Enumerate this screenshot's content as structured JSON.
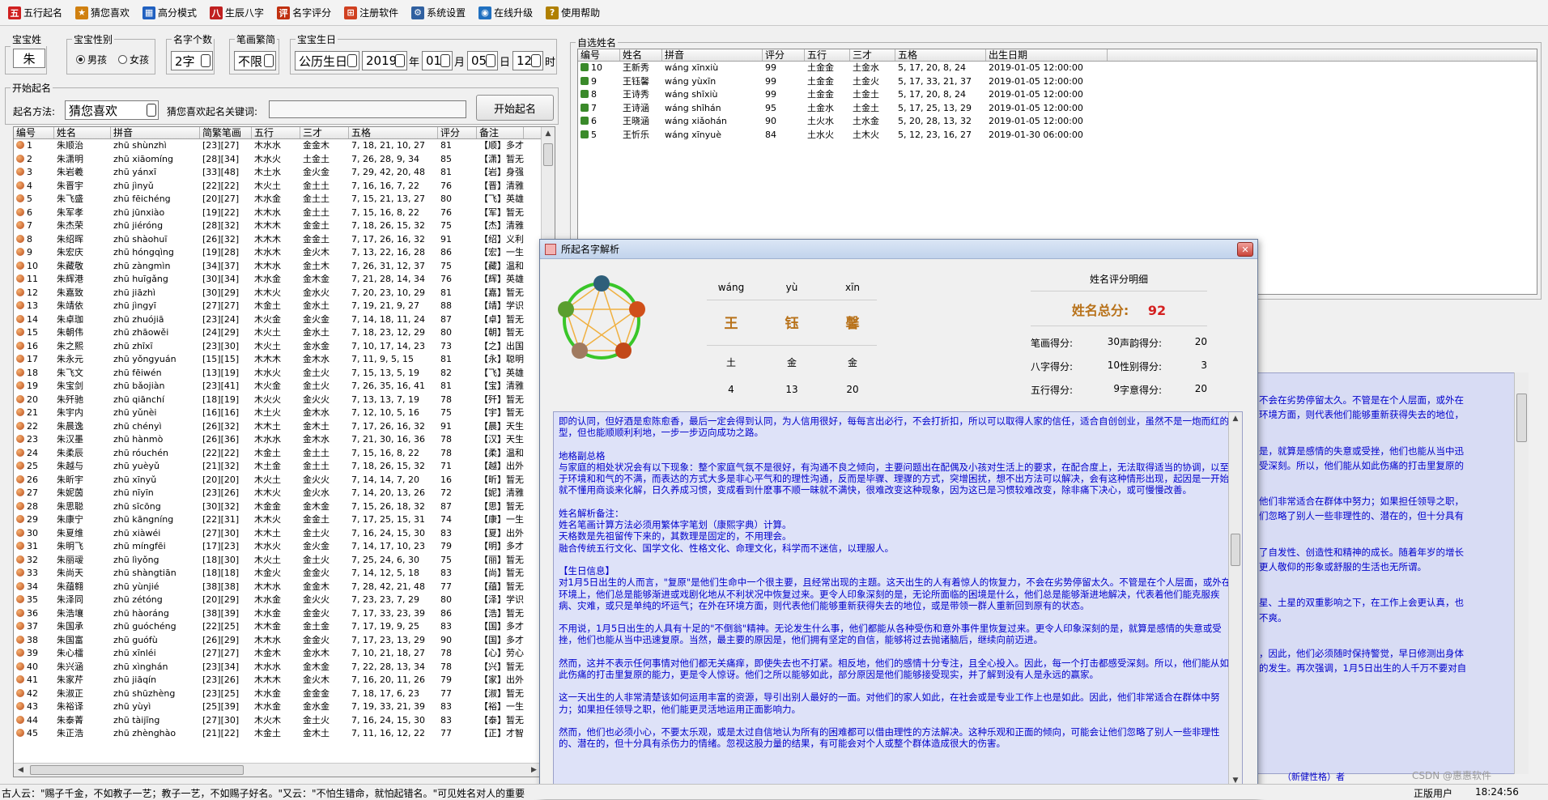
{
  "toolbar": [
    {
      "label": "五行起名",
      "icon": "book-icon",
      "color": "#d02020"
    },
    {
      "label": "猜您喜欢",
      "icon": "star-icon",
      "color": "#d08010"
    },
    {
      "label": "高分模式",
      "icon": "chart-icon",
      "color": "#2060c0"
    },
    {
      "label": "生辰八字",
      "icon": "calendar-icon",
      "color": "#c02020"
    },
    {
      "label": "名字评分",
      "icon": "score-icon",
      "color": "#c03010"
    },
    {
      "label": "注册软件",
      "icon": "gift-icon",
      "color": "#d04020"
    },
    {
      "label": "系统设置",
      "icon": "settings-icon",
      "color": "#3060a0"
    },
    {
      "label": "在线升级",
      "icon": "globe-icon",
      "color": "#2070c0"
    },
    {
      "label": "使用帮助",
      "icon": "help-icon",
      "color": "#b08000"
    }
  ],
  "baby": {
    "surname_label": "宝宝姓氏",
    "surname": "朱",
    "gender_label": "宝宝性别",
    "male": "男孩",
    "female": "女孩",
    "count_label": "名字个数",
    "count": "2字",
    "stroke_label": "笔画繁简",
    "stroke": "不限",
    "birth_label": "宝宝生日",
    "calendar": "公历生日",
    "year": "2019",
    "year_unit": "年",
    "month": "01",
    "month_unit": "月",
    "day": "05",
    "day_unit": "日",
    "hour": "12",
    "hour_unit": "时"
  },
  "start": {
    "label": "开始起名",
    "method_label": "起名方法:",
    "method": "猜您喜欢",
    "keyword_label": "猜您喜欢起名关键词:",
    "keyword": "",
    "button": "开始起名"
  },
  "names_table": {
    "columns": [
      "编号",
      "姓名",
      "拼音",
      "简繁笔画",
      "五行",
      "三才",
      "五格",
      "评分",
      "备注"
    ],
    "rows": [
      [
        "1",
        "朱顺治",
        "zhū shùnzhì",
        "[23][27]",
        "木水水",
        "金金木",
        "7, 18, 21, 10, 27",
        "81",
        "【顺】多才"
      ],
      [
        "2",
        "朱潇明",
        "zhū xiāomíng",
        "[28][34]",
        "木水火",
        "土金土",
        "7, 26, 28, 9, 34",
        "85",
        "【潇】暂无"
      ],
      [
        "3",
        "朱岩羲",
        "zhū yánxī",
        "[33][48]",
        "木土水",
        "金火金",
        "7, 29, 42, 20, 48",
        "81",
        "【岩】身强"
      ],
      [
        "4",
        "朱晋宇",
        "zhū jìnyǔ",
        "[22][22]",
        "木火土",
        "金土土",
        "7, 16, 16, 7, 22",
        "76",
        "【晋】清雅"
      ],
      [
        "5",
        "朱飞盛",
        "zhū fēichéng",
        "[20][27]",
        "木水金",
        "金土土",
        "7, 15, 21, 13, 27",
        "80",
        "【飞】英雄"
      ],
      [
        "6",
        "朱军孝",
        "zhū jūnxiào",
        "[19][22]",
        "木木水",
        "金土土",
        "7, 15, 16, 8, 22",
        "76",
        "【军】暂无"
      ],
      [
        "7",
        "朱杰荣",
        "zhū jiéróng",
        "[28][32]",
        "木木木",
        "金金土",
        "7, 18, 26, 15, 32",
        "75",
        "【杰】清雅"
      ],
      [
        "8",
        "朱绍晖",
        "zhū shàohuī",
        "[26][32]",
        "木木木",
        "金金土",
        "7, 17, 26, 16, 32",
        "91",
        "【绍】义利"
      ],
      [
        "9",
        "朱宏庆",
        "zhū hóngqìng",
        "[19][28]",
        "木水木",
        "金火木",
        "7, 13, 22, 16, 28",
        "86",
        "【宏】一生"
      ],
      [
        "10",
        "朱藏敬",
        "zhū zàngmìn",
        "[34][37]",
        "木木水",
        "金土木",
        "7, 26, 31, 12, 37",
        "75",
        "【藏】温和"
      ],
      [
        "11",
        "朱辉港",
        "zhū huīgǎng",
        "[30][34]",
        "木水金",
        "金木金",
        "7, 21, 28, 14, 34",
        "76",
        "【辉】英雄"
      ],
      [
        "12",
        "朱嘉致",
        "zhū jiāzhì",
        "[30][29]",
        "木木火",
        "金水火",
        "7, 20, 23, 10, 29",
        "81",
        "【嘉】暂无"
      ],
      [
        "13",
        "朱靖依",
        "zhū jìngyī",
        "[27][27]",
        "木金土",
        "金水土",
        "7, 19, 21, 9, 27",
        "88",
        "【靖】学识"
      ],
      [
        "14",
        "朱卓珈",
        "zhū zhuójiā",
        "[23][24]",
        "木火金",
        "金火金",
        "7, 14, 18, 11, 24",
        "87",
        "【卓】暂无"
      ],
      [
        "15",
        "朱朝伟",
        "zhū zhāowěi",
        "[24][29]",
        "木火土",
        "金水土",
        "7, 18, 23, 12, 29",
        "80",
        "【朝】暂无"
      ],
      [
        "16",
        "朱之熙",
        "zhū zhīxī",
        "[23][30]",
        "木火土",
        "金水金",
        "7, 10, 17, 14, 23",
        "73",
        "【之】出国"
      ],
      [
        "17",
        "朱永元",
        "zhū yǒngyuán",
        "[15][15]",
        "木木木",
        "金木水",
        "7, 11, 9, 5, 15",
        "81",
        "【永】聪明"
      ],
      [
        "18",
        "朱飞文",
        "zhū fēiwén",
        "[13][19]",
        "木水火",
        "金土火",
        "7, 15, 13, 5, 19",
        "82",
        "【飞】英雄"
      ],
      [
        "19",
        "朱宝剑",
        "zhū bǎojiàn",
        "[23][41]",
        "木火金",
        "金土火",
        "7, 26, 35, 16, 41",
        "81",
        "【宝】清雅"
      ],
      [
        "20",
        "朱歼驰",
        "zhū qiānchí",
        "[18][19]",
        "木火火",
        "金火火",
        "7, 13, 13, 7, 19",
        "78",
        "【歼】暂无"
      ],
      [
        "21",
        "朱宇内",
        "zhū yǔnèi",
        "[16][16]",
        "木土火",
        "金木水",
        "7, 12, 10, 5, 16",
        "75",
        "【宇】暂无"
      ],
      [
        "22",
        "朱晨逸",
        "zhū chényì",
        "[26][32]",
        "木木土",
        "金木土",
        "7, 17, 26, 16, 32",
        "91",
        "【晨】天生"
      ],
      [
        "23",
        "朱汉墨",
        "zhū hànmò",
        "[26][36]",
        "木水水",
        "金木水",
        "7, 21, 30, 16, 36",
        "78",
        "【汉】天生"
      ],
      [
        "24",
        "朱柔辰",
        "zhū róuchén",
        "[22][22]",
        "木金土",
        "金土土",
        "7, 15, 16, 8, 22",
        "78",
        "【柔】温和"
      ],
      [
        "25",
        "朱越与",
        "zhū yuèyǔ",
        "[21][32]",
        "木土金",
        "金土土",
        "7, 18, 26, 15, 32",
        "71",
        "【越】出外"
      ],
      [
        "26",
        "朱昕宇",
        "zhū xīnyǔ",
        "[20][20]",
        "木火土",
        "金火火",
        "7, 14, 14, 7, 20",
        "16",
        "【昕】暂无"
      ],
      [
        "27",
        "朱妮茵",
        "zhū nīyīn",
        "[23][26]",
        "木木火",
        "金火水",
        "7, 14, 20, 13, 26",
        "72",
        "【妮】清雅"
      ],
      [
        "28",
        "朱思聪",
        "zhū sīcōng",
        "[30][32]",
        "木金金",
        "金木金",
        "7, 15, 26, 18, 32",
        "87",
        "【思】暂无"
      ],
      [
        "29",
        "朱康宁",
        "zhū kāngníng",
        "[22][31]",
        "木木火",
        "金金土",
        "7, 17, 25, 15, 31",
        "74",
        "【康】一生"
      ],
      [
        "30",
        "朱夏维",
        "zhū xiàwéi",
        "[27][30]",
        "木木土",
        "金土火",
        "7, 16, 24, 15, 30",
        "83",
        "【夏】出外"
      ],
      [
        "31",
        "朱明飞",
        "zhū míngfēi",
        "[17][23]",
        "木水火",
        "金火金",
        "7, 14, 17, 10, 23",
        "79",
        "【明】多才"
      ],
      [
        "32",
        "朱丽叆",
        "zhū lìyǒng",
        "[18][30]",
        "木火土",
        "金土火",
        "7, 25, 24, 6, 30",
        "75",
        "【丽】暂无"
      ],
      [
        "33",
        "朱尚天",
        "zhū shàngtiān",
        "[18][18]",
        "木金火",
        "金金火",
        "7, 14, 12, 5, 18",
        "83",
        "【尚】暂无"
      ],
      [
        "34",
        "朱蕴翱",
        "zhū yùnjié",
        "[38][38]",
        "木木水",
        "金金木",
        "7, 28, 42, 21, 48",
        "77",
        "【蕴】暂无"
      ],
      [
        "35",
        "朱泽同",
        "zhū zétóng",
        "[20][29]",
        "木水金",
        "金火火",
        "7, 23, 23, 7, 29",
        "80",
        "【泽】学识"
      ],
      [
        "36",
        "朱浩壤",
        "zhū hàoráng",
        "[38][39]",
        "木水金",
        "金金火",
        "7, 17, 33, 23, 39",
        "86",
        "【浩】暂无"
      ],
      [
        "37",
        "朱国承",
        "zhū guóchéng",
        "[22][25]",
        "木木金",
        "金土金",
        "7, 17, 19, 9, 25",
        "83",
        "【国】多才"
      ],
      [
        "38",
        "朱国富",
        "zhū guófù",
        "[26][29]",
        "木木水",
        "金金火",
        "7, 17, 23, 13, 29",
        "90",
        "【国】多才"
      ],
      [
        "39",
        "朱心檑",
        "zhū xīnléi",
        "[27][27]",
        "木金木",
        "金水木",
        "7, 10, 21, 18, 27",
        "78",
        "【心】劳心"
      ],
      [
        "40",
        "朱兴涵",
        "zhū xìnghán",
        "[23][34]",
        "木水水",
        "金木金",
        "7, 22, 28, 13, 34",
        "78",
        "【兴】暂无"
      ],
      [
        "41",
        "朱家芹",
        "zhū jiāqín",
        "[23][26]",
        "木木木",
        "金火木",
        "7, 16, 20, 11, 26",
        "79",
        "【家】出外"
      ],
      [
        "42",
        "朱淑正",
        "zhū shūzhèng",
        "[23][25]",
        "木水金",
        "金金金",
        "7, 18, 17, 6, 23",
        "77",
        "【淑】暂无"
      ],
      [
        "43",
        "朱裕译",
        "zhū yùyì",
        "[25][39]",
        "木水金",
        "金水金",
        "7, 19, 33, 21, 39",
        "83",
        "【裕】一生"
      ],
      [
        "44",
        "朱泰菁",
        "zhū tàijīng",
        "[27][30]",
        "木火木",
        "金土火",
        "7, 16, 24, 15, 30",
        "83",
        "【泰】暂无"
      ],
      [
        "45",
        "朱正浩",
        "zhū zhènghào",
        "[21][22]",
        "木金土",
        "金木土",
        "7, 11, 16, 12, 22",
        "77",
        "【正】才智"
      ]
    ]
  },
  "selected": {
    "title": "自选姓名",
    "columns": [
      "编号",
      "姓名",
      "拼音",
      "评分",
      "五行",
      "三才",
      "五格",
      "出生日期"
    ],
    "rows": [
      [
        "10",
        "王新秀",
        "wáng xīnxiù",
        "99",
        "土金金",
        "土金水",
        "5, 17, 20, 8, 24",
        "2019-01-05 12:00:00"
      ],
      [
        "9",
        "王钰馨",
        "wáng yùxīn",
        "99",
        "土金金",
        "土金火",
        "5, 17, 33, 21, 37",
        "2019-01-05 12:00:00"
      ],
      [
        "8",
        "王诗秀",
        "wáng shīxiù",
        "99",
        "土金金",
        "土金土",
        "5, 17, 20, 8, 24",
        "2019-01-05 12:00:00"
      ],
      [
        "7",
        "王诗涵",
        "wáng shīhán",
        "95",
        "土金水",
        "土金土",
        "5, 17, 25, 13, 29",
        "2019-01-05 12:00:00"
      ],
      [
        "6",
        "王晓涵",
        "wáng xiǎohán",
        "90",
        "土火水",
        "土水金",
        "5, 20, 28, 13, 32",
        "2019-01-05 12:00:00"
      ],
      [
        "5",
        "王忻乐",
        "wáng xīnyuè",
        "84",
        "土水火",
        "土木火",
        "5, 12, 23, 16, 27",
        "2019-01-30 06:00:00"
      ]
    ]
  },
  "dialog": {
    "title": "所起名字解析",
    "pinyin": [
      "wáng",
      "yù",
      "xīn"
    ],
    "chars": [
      "王",
      "钰",
      "馨"
    ],
    "elements": [
      "土",
      "金",
      "金"
    ],
    "strokes": [
      "4",
      "13",
      "20"
    ],
    "detail_title": "姓名评分明细",
    "total_label": "姓名总分:",
    "total": "92",
    "scores": [
      [
        "笔画得分:",
        "30",
        "声韵得分:",
        "20"
      ],
      [
        "八字得分:",
        "10",
        "性别得分:",
        "3"
      ],
      [
        "五行得分:",
        "9",
        "字意得分:",
        "20"
      ]
    ],
    "paragraphs": [
      "即的认同，但好酒是愈陈愈香，最后一定会得到认同，为人信用很好，每每言出必行，不会打折扣，所以可以取得人家的信任，适合自创创业，虽然不是一炮而红的型，但也能顺顺利利地，一步一步迈向成功之路。",
      "地格副总格\n与家庭的相处状况会有以下现象：整个家庭气氛不是很好，有沟通不良之倾向，主要问题出在配偶及小孩对生活上的要求，在配合度上，无法取得适当的协调，以至于环境和和气的不满，而表达的方式大多是非心平气和的理性沟通，反而是毕骤、理骤的方式，突增困扰，想不出方法可以解决，会有这种情形出现，起因是一开始就不懂用商谈来化解，日久养成习惯，变成看到什麽事不顺一昧就不满快，很难改变这种现象，因为这已是习惯较难改变，除非痛下决心，或可慢慢改善。",
      "姓名解析备注：\n姓名笔画计算方法必须用繁体字笔划（康熙字典）计算。\n天格数是先祖留传下来的，其数理是固定的，不用理会。\n融合传统五行文化、国学文化、性格文化、命理文化，科学而不迷信，以理服人。",
      "【生日信息】\n对1月5日出生的人而言，\"复原\"是他们生命中一个很主要，且经常出现的主题。这天出生的人有着惊人的恢复力，不会在劣势停留太久。不管是在个人层面，或外在环境上，他们总是能够渐进或戏剧化地从不利状况中恢复过来。更令人印象深刻的是，无论所面临的困境是什么，他们总是能够渐进地解决，代表着他们能克服疾病、灾难，或只是单纯的坏运气；在外在环境方面，则代表他们能够重新获得失去的地位，或是带领一群人重新回到原有的状态。",
      "不用说，1月5日出生的人具有十足的\"不倒翁\"精神。无论发生什么事，他们都能从各种受伤和意外事件里恢复过来。更令人印象深刻的是，就算是感情的失意或受挫，他们也能从当中迅速复原。当然，最主要的原因是，他们拥有坚定的自信，能够将过去抛诸脑后，继续向前迈进。",
      "然而，这并不表示任何事情对他们都无关痛痒，即使失去也不打紧。相反地，他们的感情十分专注，且全心投入。因此，每一个打击都感受深刻。所以，他们能从如此伤痛的打击里复原的能力，更是令人惊讶。他们之所以能够如此，部分原因是他们能够接受现实，并了解到没有人是永远的赢家。",
      "这一天出生的人非常清楚该如何运用丰富的资源，导引出别人最好的一面。对他们的家人如此，在社会或是专业工作上也是如此。因此，他们非常适合在群体中努力；如果担任领导之职，他们能更灵活地运用正面影响力。",
      "然而，他们也必须小心，不要太乐观，或是太过自信地认为所有的困难都可以借由理性的方法解决。这种乐观和正面的倾向，可能会让他们忽略了别人一些非理性的、潜在的，但十分具有杀伤力的情绪。忽视这股力量的结果，有可能会对个人或整个群体造成很大的伤害。"
    ]
  },
  "right_panel": [
    "不会在劣势停留太久。不管是在个人层面，或外在",
    "环境方面，则代表他们能够重新获得失去的地位，",
    "是，就算是感情的失意或受挫，他们也能从当中迅",
    "受深刻。所以，他们能从如此伤痛的打击里复原的",
    "他们非常适合在群体中努力；如果担任领导之职，",
    "们忽略了别人一些非理性的、潜在的，但十分具有",
    "了自发性、创造性和精神的成长。随着年岁的增长",
    "更人敬仰的形象或舒服的生活也无所谓。",
    "星、土星的双重影响之下，在工作上会更认真，也",
    "不爽。",
    "，因此，他们必须随时保持警觉，早日修测出身体",
    "的发生。再次强调，1月5日出生的人千万不要对自"
  ],
  "status": {
    "quote": "古人云：\"赐子千金，不如教子一艺；教子一艺，不如赐子好名。\"又云：\"不怕生错命，就怕起错名。\"可见姓名对人的重要",
    "right_tail": "（新健性格）者",
    "edition": "正版用户",
    "time": "18:24:56",
    "watermark": "CSDN @惠惠软件"
  }
}
